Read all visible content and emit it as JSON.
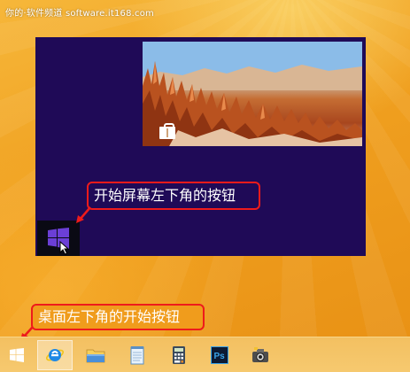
{
  "watermark": "你的·软件频道 software.it168.com",
  "start_screen": {
    "photo_tile": {
      "icon": "store-icon"
    },
    "start_button": {
      "icon": "windows-logo-icon"
    }
  },
  "callouts": {
    "start_screen_button": "开始屏幕左下角的按钮",
    "desktop_start_button": "桌面左下角的开始按钮"
  },
  "taskbar": {
    "items": [
      {
        "icon": "windows-logo-icon"
      },
      {
        "icon": "internet-explorer-icon",
        "active": true
      },
      {
        "icon": "file-explorer-icon"
      },
      {
        "icon": "notepad-icon"
      },
      {
        "icon": "calculator-icon"
      },
      {
        "icon": "photoshop-icon",
        "label": "Ps"
      },
      {
        "icon": "camera-app-icon"
      }
    ]
  },
  "colors": {
    "start_screen_bg": "#1f0a57",
    "callout_border": "#ee1b1b",
    "desktop_bg": "#f0a020",
    "windows_logo": "#6b3fd6"
  }
}
